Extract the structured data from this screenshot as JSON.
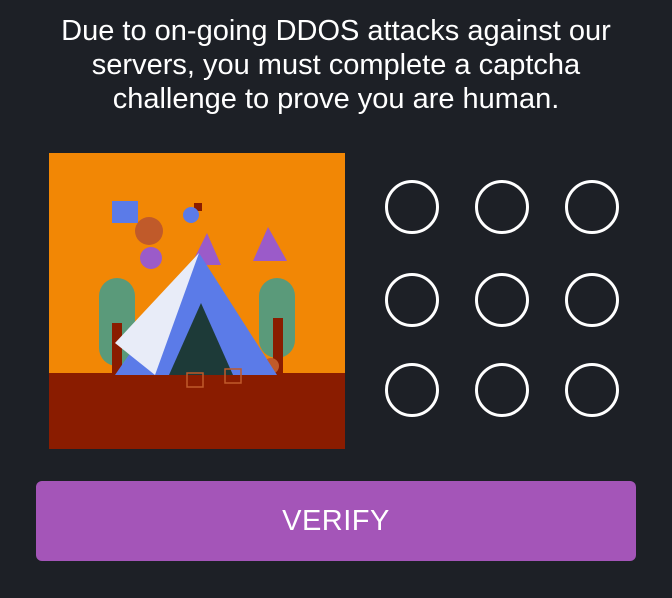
{
  "instruction": {
    "line1": "Due to on-going DDOS attacks against our",
    "line2": "servers, you must complete a captcha",
    "line3": "challenge to prove you are human."
  },
  "challenge_image": {
    "description_colors": {
      "sky": "#f28705",
      "ground": "#8a1c00",
      "tent": "#5b7be8",
      "trees": "#5a9a7a",
      "triangle": "#9b5bc9"
    }
  },
  "grid": {
    "rows": 3,
    "columns": 3,
    "circle_color": "#ffffff"
  },
  "verify_button": {
    "label": "VERIFY",
    "color": "#a455b8"
  }
}
